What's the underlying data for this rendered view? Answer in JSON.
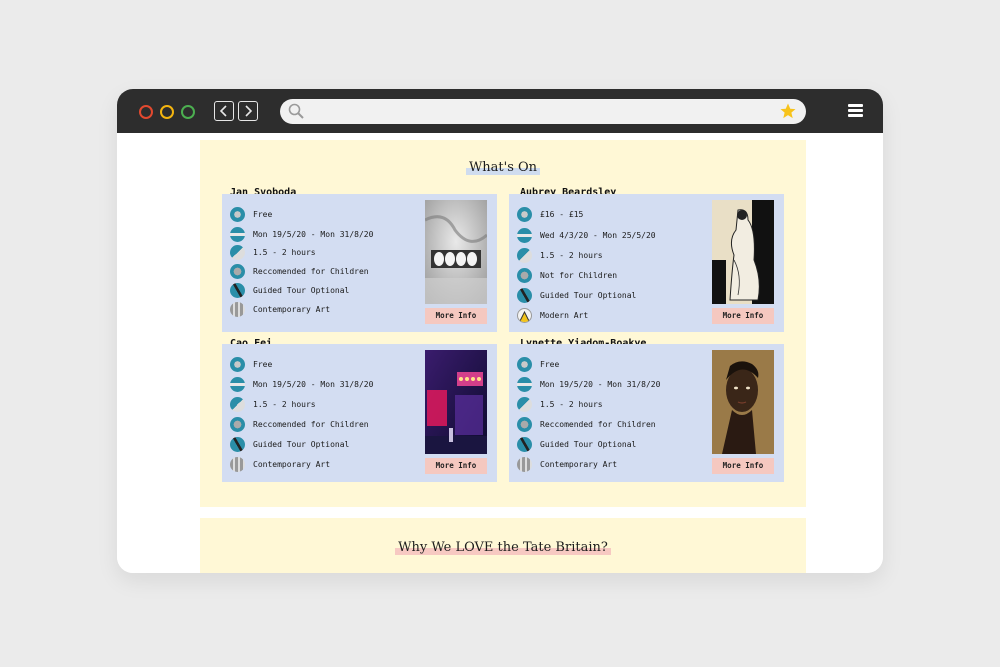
{
  "browser": {
    "nav_back_icon": "chevron-left-icon",
    "nav_forward_icon": "chevron-right-icon",
    "search_icon": "search-icon",
    "bookmark_icon": "star-icon",
    "menu_icon": "hamburger-menu-icon",
    "address_value": ""
  },
  "whats_on": {
    "title": "What's On",
    "more_info_label": "More Info",
    "exhibitions": [
      {
        "artist": "Jan Svoboda",
        "price": "Free",
        "dates": "Mon 19/5/20 - Mon 31/8/20",
        "duration": "1.5 - 2 hours",
        "audience": "Reccomended for Children",
        "tour": "Guided Tour Optional",
        "genre": "Contemporary Art"
      },
      {
        "artist": "Aubrey Beardsley",
        "price": "£16 - £15",
        "dates": "Wed 4/3/20 - Mon 25/5/20",
        "duration": "1.5 - 2 hours",
        "audience": "Not for Children",
        "tour": "Guided Tour Optional",
        "genre": "Modern Art"
      },
      {
        "artist": "Cao Fei",
        "price": "Free",
        "dates": "Mon 19/5/20 - Mon 31/8/20",
        "duration": "1.5 - 2 hours",
        "audience": "Reccomended for Children",
        "tour": "Guided Tour Optional",
        "genre": "Contemporary Art"
      },
      {
        "artist": "Lynette Yiadom-Boakye",
        "price": "Free",
        "dates": "Mon 19/5/20 - Mon 31/8/20",
        "duration": "1.5 - 2 hours",
        "audience": "Reccomended for Children",
        "tour": "Guided Tour Optional",
        "genre": "Contemporary Art"
      }
    ]
  },
  "why_love": {
    "title": "Why We LOVE the Tate Britain?"
  },
  "colors": {
    "panel": "#fff8d6",
    "card": "#d3ddf2",
    "button": "#f5c8c0",
    "chrome": "#2d2d2d"
  }
}
